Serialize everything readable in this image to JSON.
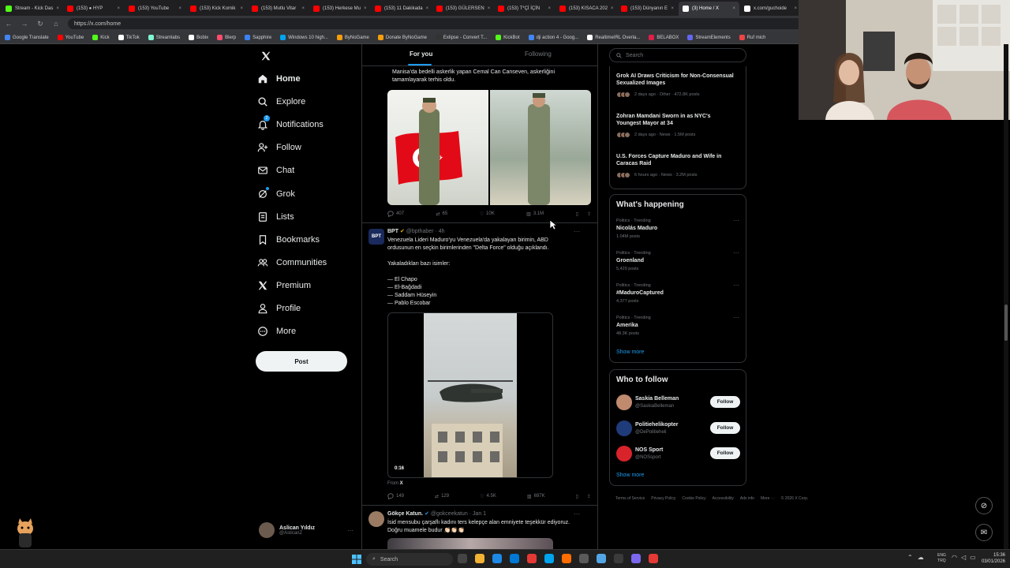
{
  "browser": {
    "tabs": [
      {
        "title": "Stream - Kick Das",
        "color": "#53fc18"
      },
      {
        "title": "(153) ● HYP",
        "color": "#ff0000"
      },
      {
        "title": "(153) YouTube",
        "color": "#ff0000"
      },
      {
        "title": "(153) Kick Komik",
        "color": "#ff0000"
      },
      {
        "title": "(153) Mutlu Vitar",
        "color": "#ff0000"
      },
      {
        "title": "(153) Herkese Mu",
        "color": "#ff0000"
      },
      {
        "title": "(153) 11 Dakikada",
        "color": "#ff0000"
      },
      {
        "title": "(153) GÜLERSEN",
        "color": "#ff0000"
      },
      {
        "title": "(153) T*Çİ İÇİN",
        "color": "#ff0000"
      },
      {
        "title": "(153) KISACA 202",
        "color": "#ff0000"
      },
      {
        "title": "(153) Dünyanın E",
        "color": "#ff0000"
      },
      {
        "title": "(3) Home / X",
        "color": "#ffffff",
        "active": true
      },
      {
        "title": "x.com/guchoide",
        "color": "#ffffff"
      }
    ],
    "url": "https://x.com/home",
    "bookmarks": [
      {
        "label": "Google Translate",
        "color": "#4285f4"
      },
      {
        "label": "YouTube",
        "color": "#ff0000"
      },
      {
        "label": "Kick",
        "color": "#53fc18"
      },
      {
        "label": "TikTok",
        "color": "#ffffff"
      },
      {
        "label": "Streamlabs",
        "color": "#80f5d2"
      },
      {
        "label": "Bobix",
        "color": "#ffffff"
      },
      {
        "label": "Blerp",
        "color": "#ff4b6e"
      },
      {
        "label": "Sapphire",
        "color": "#3b82f6"
      },
      {
        "label": "Windows 10 high...",
        "color": "#00a4ef"
      },
      {
        "label": "ByNoGame",
        "color": "#f59e0b"
      },
      {
        "label": "Donate ByNoGame",
        "color": "#f59e0b"
      },
      {
        "label": "Exlipse - Convert T...",
        "color": "#333333"
      },
      {
        "label": "KickBot",
        "color": "#53fc18"
      },
      {
        "label": "dji action 4 - Goog...",
        "color": "#4285f4"
      },
      {
        "label": "RealtimeIRL Overla...",
        "color": "#ffffff"
      },
      {
        "label": "BELABOX",
        "color": "#e11d48"
      },
      {
        "label": "StreamElements",
        "color": "#6366f1"
      },
      {
        "label": "Ruf mich",
        "color": "#ef4444"
      }
    ]
  },
  "nav": {
    "items": [
      {
        "label": "Home",
        "icon": "home-icon"
      },
      {
        "label": "Explore",
        "icon": "search-icon"
      },
      {
        "label": "Notifications",
        "icon": "bell-icon"
      },
      {
        "label": "Follow",
        "icon": "person-plus-icon"
      },
      {
        "label": "Chat",
        "icon": "mail-icon"
      },
      {
        "label": "Grok",
        "icon": "grok-icon"
      },
      {
        "label": "Lists",
        "icon": "list-icon"
      },
      {
        "label": "Bookmarks",
        "icon": "bookmark-icon"
      },
      {
        "label": "Communities",
        "icon": "people-icon"
      },
      {
        "label": "Premium",
        "icon": "x-logo-icon"
      },
      {
        "label": "Profile",
        "icon": "person-icon"
      },
      {
        "label": "More",
        "icon": "more-circle-icon"
      }
    ],
    "post_label": "Post",
    "notifications_badge": "2",
    "account": {
      "name": "Aslican Yıldız",
      "handle": "@AslicanZ"
    }
  },
  "feed": {
    "tabs": [
      "For you",
      "Following"
    ],
    "tweet1": {
      "text": "Manisa'da bedelli askerlik yapan Cemal Can Canseven, askerliğini tamamlayarak terhis oldu.",
      "replies": "407",
      "reposts": "65",
      "likes": "10K",
      "views": "3.1M"
    },
    "tweet2": {
      "name": "BPT",
      "handle": "@bpthaber · 4h",
      "lines": [
        "Venezuela Lideri Maduro'yu Venezuela'da yakalayan birimin, ABD",
        "ordusunun en seçkin birimlerinden \"Delta Force\" olduğu açıklandı.",
        "",
        "Yakaladıkları bazı isimler:",
        "",
        "— El Chapo",
        "— El-Bağdadi",
        "— Saddam Hüseyin",
        "— Pablo Escobar"
      ],
      "video_time": "0:16",
      "from": "From",
      "replies": "149",
      "reposts": "129",
      "likes": "4.5K",
      "views": "697K"
    },
    "tweet3": {
      "name": "Gökçe Katun.",
      "handle": "@gokceekatun · Jan 1",
      "lines": [
        "İsid mensubu çarşaflı kadını ters kelepçe alan emniyete teşekkür ediyoruz.",
        "Doğru muamele budur 👏🏻👏🏻👏🏻"
      ]
    }
  },
  "right": {
    "search_placeholder": "Search",
    "news": [
      {
        "title": "Grok AI Draws Criticism for Non-Consensual Sexualized Images",
        "meta": "2 days ago · Other · 472.8K posts"
      },
      {
        "title": "Zohran Mamdani Sworn in as NYC's Youngest Mayor at 34",
        "meta": "2 days ago · News · 1.5M posts"
      },
      {
        "title": "U.S. Forces Capture Maduro and Wife in Caracas Raid",
        "meta": "6 hours ago · News · 3.2M posts"
      }
    ],
    "happening_title": "What's happening",
    "trends": [
      {
        "context": "Politics · Trending",
        "name": "Nicolás Maduro",
        "posts": "1.04M posts"
      },
      {
        "context": "Politics · Trending",
        "name": "Groenland",
        "posts": "5,429 posts"
      },
      {
        "context": "Politics · Trending",
        "name": "#MaduroCaptured",
        "posts": "4,377 posts"
      },
      {
        "context": "Politics · Trending",
        "name": "Amerika",
        "posts": "48.3K posts"
      }
    ],
    "show_more": "Show more",
    "wtf_title": "Who to follow",
    "wtf": [
      {
        "name": "Saskia Belleman",
        "handle": "@SaskiaBelleman",
        "button": "Follow"
      },
      {
        "name": "Politiehelikopter",
        "handle": "@DePolitieheli",
        "button": "Follow"
      },
      {
        "name": "NOS Sport",
        "handle": "@NOSsport",
        "button": "Follow"
      }
    ],
    "footer": [
      "Terms of Service",
      "Privacy Policy",
      "Cookie Policy",
      "Accessibility",
      "Ads info",
      "More ···",
      "© 2026 X Corp."
    ]
  },
  "taskbar": {
    "search_placeholder": "Search",
    "lang": "ENG\nTRQ",
    "time": "15:36",
    "date": "03/01/2026"
  }
}
